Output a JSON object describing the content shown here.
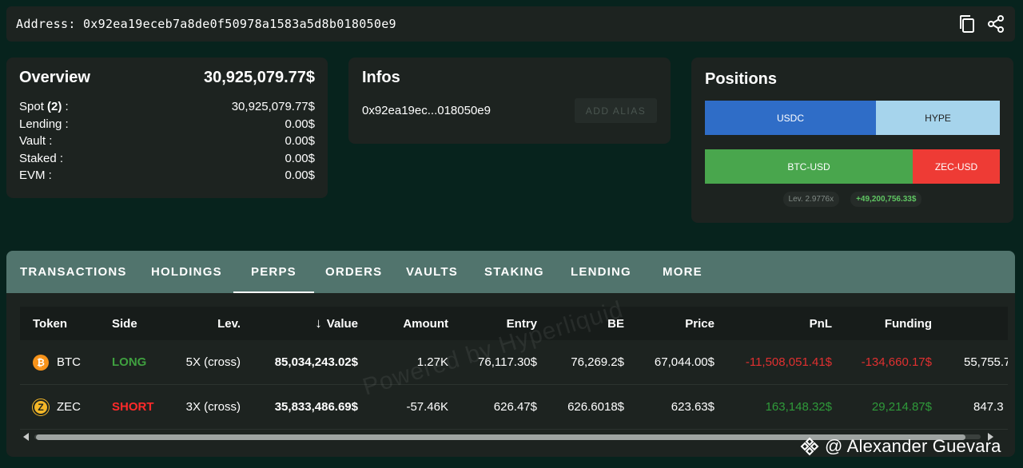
{
  "address_bar": {
    "label": "Address: 0x92ea19eceb7a8de0f50978a1583a5d8b018050e9",
    "icons": [
      "copy-icon",
      "share-icon"
    ]
  },
  "overview": {
    "title": "Overview",
    "total": "30,925,079.77$",
    "rows": [
      {
        "label_prefix": "Spot ",
        "label_count": "(2)",
        "label_suffix": " :",
        "value": "30,925,079.77$"
      },
      {
        "label": "Lending :",
        "value": "0.00$"
      },
      {
        "label": "Vault :",
        "value": "0.00$"
      },
      {
        "label": "Staked :",
        "value": "0.00$"
      },
      {
        "label": "EVM :",
        "value": "0.00$"
      }
    ]
  },
  "infos": {
    "title": "Infos",
    "address": "0x92ea19ec...018050e9",
    "alias_button": "ADD ALIAS"
  },
  "positions": {
    "title": "Positions",
    "spot_bar": [
      {
        "label": "USDC",
        "color": "#2f6dc7",
        "share": 0.58
      },
      {
        "label": "HYPE",
        "color": "#a6d4ec",
        "share": 0.42
      }
    ],
    "perp_bar": [
      {
        "label": "BTC-USD",
        "color": "#49a64d",
        "share": 0.7
      },
      {
        "label": "ZEC-USD",
        "color": "#ee3b35",
        "share": 0.3
      }
    ],
    "leverage_badge": "Lev. 2.9776x",
    "pnl_badge": "+49,200,756.33$"
  },
  "tabs": [
    "TRANSACTIONS",
    "HOLDINGS",
    "PERPS",
    "ORDERS",
    "VAULTS",
    "STAKING",
    "LENDING",
    "MORE"
  ],
  "active_tab": "PERPS",
  "table": {
    "headers": [
      "Token",
      "Side",
      "Lev.",
      "Value",
      "Amount",
      "Entry",
      "BE",
      "Price",
      "PnL",
      "Funding"
    ],
    "sort_indicator": "↓",
    "rows": [
      {
        "token": "BTC",
        "icon": "bitcoin-icon",
        "side": "LONG",
        "lev": "5X (cross)",
        "value": "85,034,243.02$",
        "amount": "1.27K",
        "entry": "76,117.30$",
        "be": "76,269.2$",
        "price": "67,044.00$",
        "pnl": "-11,508,051.41$",
        "funding": "-134,660.17$",
        "extra": "55,755.7"
      },
      {
        "token": "ZEC",
        "icon": "zcash-icon",
        "side": "SHORT",
        "lev": "3X (cross)",
        "value": "35,833,486.69$",
        "amount": "-57.46K",
        "entry": "626.47$",
        "be": "626.6018$",
        "price": "623.63$",
        "pnl": "163,148.32$",
        "funding": "29,214.87$",
        "extra": "847.3"
      }
    ]
  },
  "watermark": "Powered by Hyperliquid",
  "credit": "@ Alexander Guevara",
  "colors": {
    "background": "#07231d",
    "card": "#1d2320",
    "tab_bar": "#51746d",
    "long": "#3fa03f",
    "short": "#ff2a2a"
  }
}
